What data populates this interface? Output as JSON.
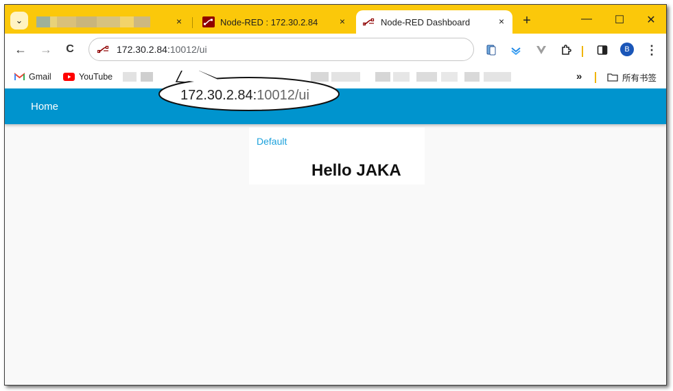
{
  "browser": {
    "tabs": [
      {
        "title": "",
        "blurred": true
      },
      {
        "title": "Node-RED : 172.30.2.84"
      },
      {
        "title": "Node-RED Dashboard",
        "active": true
      }
    ],
    "close_glyph": "×",
    "newtab_glyph": "+",
    "window_controls": {
      "minimize": "—",
      "maximize": "☐",
      "close": "✕"
    },
    "tab_search_glyph": "⌄",
    "address": {
      "host": "172.30.2.84:",
      "path": "10012/ui"
    },
    "nav": {
      "back": "←",
      "forward": "→",
      "reload": "C"
    },
    "avatar_letter": "B",
    "menu_glyph": "⋮"
  },
  "bookmarks": {
    "gmail": "Gmail",
    "youtube": "YouTube",
    "more": "»",
    "all_bookmarks": "所有书签"
  },
  "callout": {
    "host": "172.30.2.84:",
    "path": "10012/ui"
  },
  "dashboard": {
    "header_title": "Home",
    "group_label": "Default",
    "text_value": "Hello JAKA"
  },
  "colors": {
    "tabstrip": "#fbc80a",
    "header": "#0094ce",
    "group": "#1ca1dc",
    "nodered": "#8f0000"
  }
}
